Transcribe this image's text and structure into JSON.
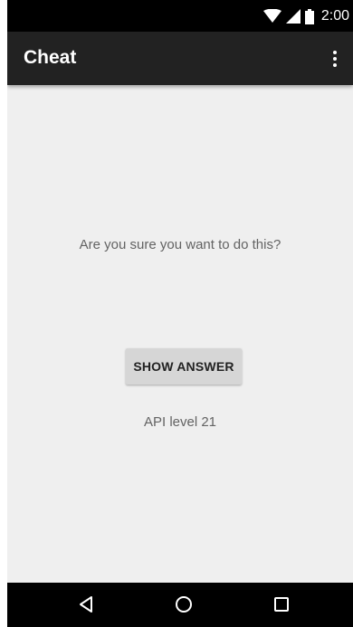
{
  "status_bar": {
    "time": "2:00",
    "icons": [
      "wifi-icon",
      "cell-signal-icon",
      "battery-icon"
    ]
  },
  "app_bar": {
    "title": "Cheat",
    "overflow_icon": "more-vert-icon"
  },
  "main": {
    "question": "Are you sure you want to do this?",
    "show_answer_label": "SHOW ANSWER",
    "api_level": "API level 21"
  },
  "nav_bar": {
    "buttons": [
      "back-icon",
      "home-icon",
      "recents-icon"
    ]
  },
  "colors": {
    "status_bar": "#000000",
    "app_bar": "#222222",
    "background": "#efefef",
    "button": "#d6d6d6",
    "text_secondary": "#636363"
  }
}
